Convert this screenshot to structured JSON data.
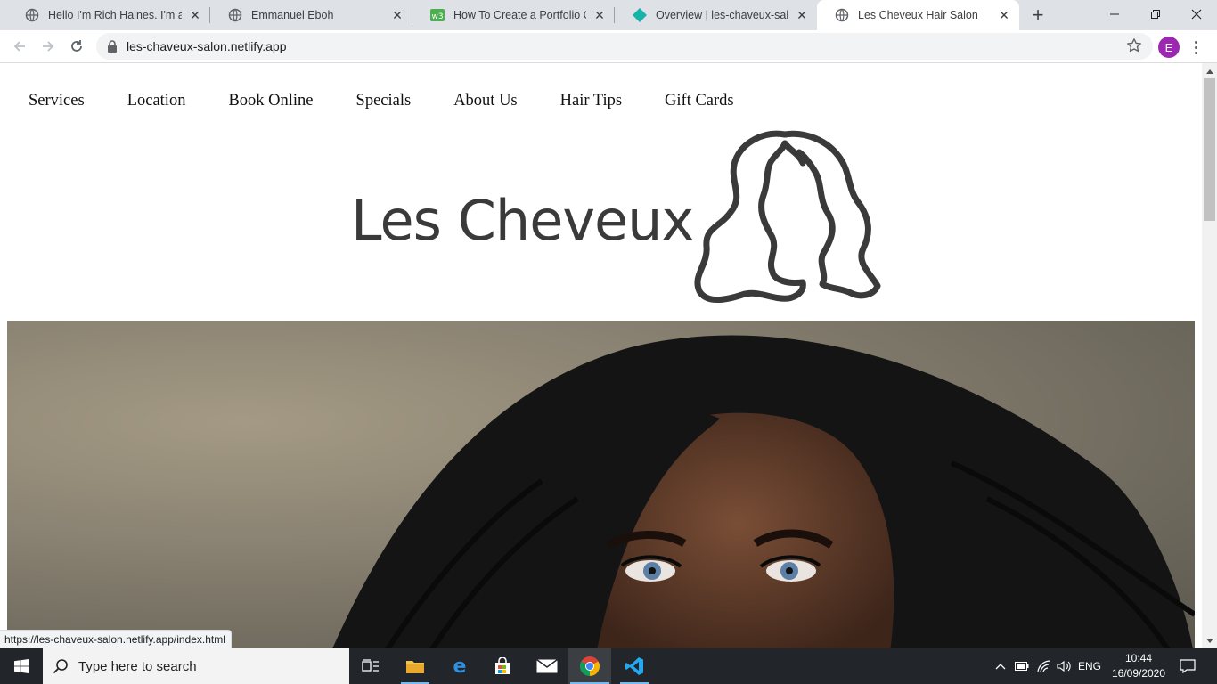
{
  "browser": {
    "tabs": [
      {
        "title": "Hello I'm Rich Haines. I'm a software engineer",
        "favicon": "globe-icon",
        "active": false
      },
      {
        "title": "Emmanuel Eboh",
        "favicon": "globe-icon",
        "active": false
      },
      {
        "title": "How To Create a Portfolio Gallery",
        "favicon": "w3schools-icon",
        "active": false
      },
      {
        "title": "Overview | les-chaveux-salon",
        "favicon": "netlify-icon",
        "active": false
      },
      {
        "title": "Les Cheveux Hair Salon",
        "favicon": "globe-icon",
        "active": true
      }
    ],
    "url": "les-chaveux-salon.netlify.app",
    "profile_initial": "E",
    "status_url": "https://les-chaveux-salon.netlify.app/index.html"
  },
  "site": {
    "nav": [
      "Services",
      "Location",
      "Book Online",
      "Specials",
      "About Us",
      "Hair Tips",
      "Gift Cards"
    ],
    "logo_text": "Les Cheveux"
  },
  "taskbar": {
    "search_placeholder": "Type here to search",
    "language": "ENG",
    "time": "10:44",
    "date": "16/09/2020"
  },
  "colors": {
    "tabstrip": "#dee1e6",
    "profile": "#9c27b0",
    "taskbar": "#22252a",
    "logo": "#3a3a3a"
  }
}
